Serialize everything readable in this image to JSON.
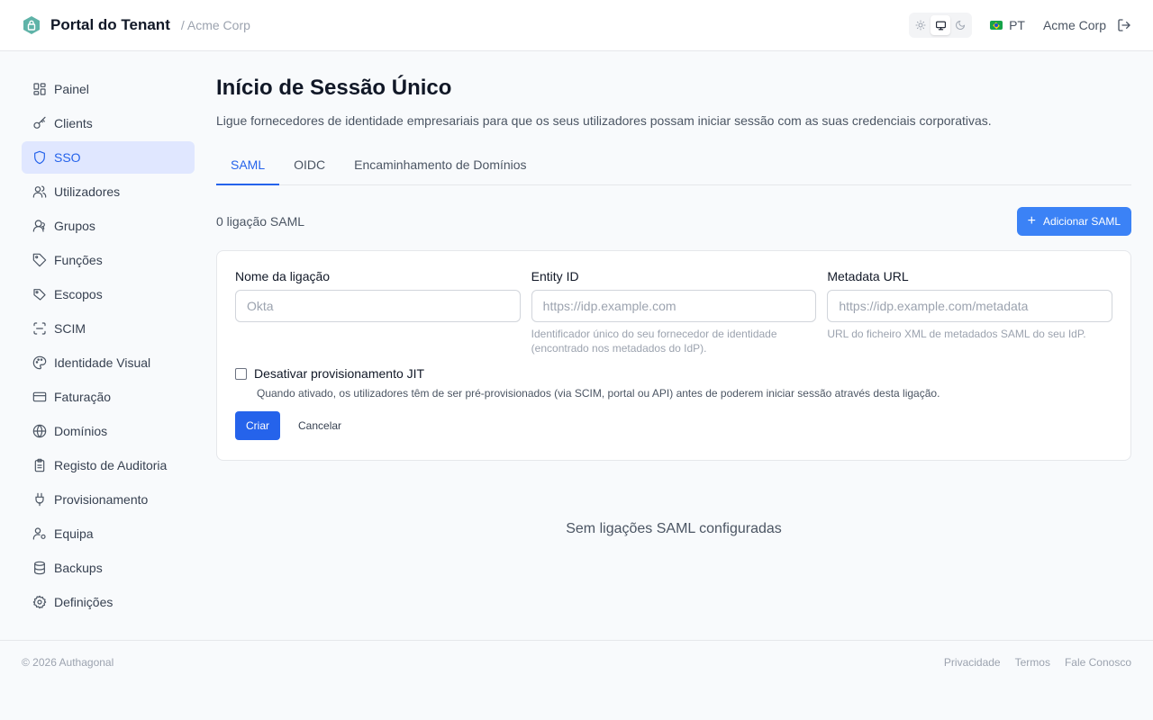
{
  "header": {
    "title": "Portal do Tenant",
    "subtitle": "/ Acme Corp",
    "logo_icon": "shield-lock-icon",
    "theme": {
      "options": [
        "light",
        "system",
        "dark"
      ],
      "selected": "system"
    },
    "language": "PT",
    "language_flag": "brazil-flag-icon",
    "tenant_name": "Acme Corp",
    "logout_icon": "logout-icon"
  },
  "sidebar": {
    "items": [
      {
        "label": "Painel",
        "icon": "dashboard-icon"
      },
      {
        "label": "Clients",
        "icon": "key-icon"
      },
      {
        "label": "SSO",
        "icon": "shield-icon",
        "active": true
      },
      {
        "label": "Utilizadores",
        "icon": "users-icon"
      },
      {
        "label": "Grupos",
        "icon": "group-icon"
      },
      {
        "label": "Funções",
        "icon": "tag-icon"
      },
      {
        "label": "Escopos",
        "icon": "tags-icon"
      },
      {
        "label": "SCIM",
        "icon": "scan-icon"
      },
      {
        "label": "Identidade Visual",
        "icon": "palette-icon"
      },
      {
        "label": "Faturação",
        "icon": "credit-card-icon"
      },
      {
        "label": "Domínios",
        "icon": "globe-icon"
      },
      {
        "label": "Registo de Auditoria",
        "icon": "clipboard-icon"
      },
      {
        "label": "Provisionamento",
        "icon": "plug-icon"
      },
      {
        "label": "Equipa",
        "icon": "user-cog-icon"
      },
      {
        "label": "Backups",
        "icon": "database-icon"
      },
      {
        "label": "Definições",
        "icon": "gear-icon"
      }
    ]
  },
  "main": {
    "title": "Início de Sessão Único",
    "description": "Ligue fornecedores de identidade empresariais para que os seus utilizadores possam iniciar sessão com as suas credenciais corporativas.",
    "tabs": [
      {
        "label": "SAML",
        "active": true
      },
      {
        "label": "OIDC"
      },
      {
        "label": "Encaminhamento de Domínios"
      }
    ],
    "count_text": "0 ligação SAML",
    "add_button": "Adicionar SAML",
    "form": {
      "name_label": "Nome da ligação",
      "name_placeholder": "Okta",
      "entity_label": "Entity ID",
      "entity_placeholder": "https://idp.example.com",
      "entity_help": "Identificador único do seu fornecedor de identidade (encontrado nos metadados do IdP).",
      "metadata_label": "Metadata URL",
      "metadata_placeholder": "https://idp.example.com/metadata",
      "metadata_help": "URL do ficheiro XML de metadados SAML do seu IdP.",
      "jit_label": "Desativar provisionamento JIT",
      "jit_checked": false,
      "jit_help": "Quando ativado, os utilizadores têm de ser pré-provisionados (via SCIM, portal ou API) antes de poderem iniciar sessão através desta ligação.",
      "create_button": "Criar",
      "cancel_button": "Cancelar"
    },
    "empty_text": "Sem ligações SAML configuradas"
  },
  "footer": {
    "copyright": "© 2026 Authagonal",
    "links": [
      "Privacidade",
      "Termos",
      "Fale Conosco"
    ]
  },
  "colors": {
    "accent": "#2563eb",
    "accent_light": "#3b82f6",
    "active_bg": "#e0e7ff",
    "logo": "#5fb3a8"
  }
}
